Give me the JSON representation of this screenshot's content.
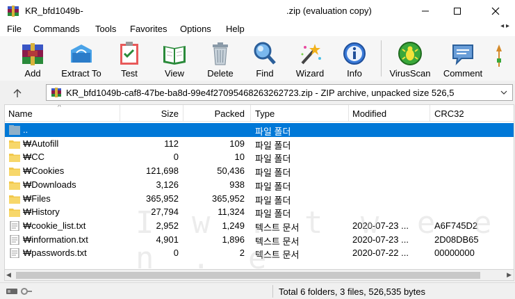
{
  "window": {
    "title_left": "KR_bfd1049b-",
    "title_right": ".zip (evaluation copy)"
  },
  "menu": [
    "File",
    "Commands",
    "Tools",
    "Favorites",
    "Options",
    "Help"
  ],
  "toolbar": [
    {
      "label": "Add",
      "icon": "add-archive-icon"
    },
    {
      "label": "Extract To",
      "icon": "extract-icon"
    },
    {
      "label": "Test",
      "icon": "test-icon"
    },
    {
      "label": "View",
      "icon": "view-book-icon"
    },
    {
      "label": "Delete",
      "icon": "trash-icon"
    },
    {
      "label": "Find",
      "icon": "magnifier-icon"
    },
    {
      "label": "Wizard",
      "icon": "wand-icon"
    },
    {
      "label": "Info",
      "icon": "info-icon"
    },
    {
      "label": "VirusScan",
      "icon": "bug-icon"
    },
    {
      "label": "Comment",
      "icon": "comment-icon"
    }
  ],
  "address": {
    "path": "KR_bfd1049b-caf8-47be-ba8d-99e4f27095468263262723.zip - ZIP archive, unpacked size 526,5"
  },
  "columns": {
    "name": "Name",
    "size": "Size",
    "packed": "Packed",
    "type": "Type",
    "modified": "Modified",
    "crc": "CRC32"
  },
  "files": [
    {
      "name": "..",
      "size": "",
      "packed": "",
      "type": "파일 폴더",
      "modified": "",
      "crc": "",
      "kind": "parent"
    },
    {
      "name": "₩Autofill",
      "size": "112",
      "packed": "109",
      "type": "파일 폴더",
      "modified": "",
      "crc": "",
      "kind": "folder"
    },
    {
      "name": "₩CC",
      "size": "0",
      "packed": "10",
      "type": "파일 폴더",
      "modified": "",
      "crc": "",
      "kind": "folder"
    },
    {
      "name": "₩Cookies",
      "size": "121,698",
      "packed": "50,436",
      "type": "파일 폴더",
      "modified": "",
      "crc": "",
      "kind": "folder"
    },
    {
      "name": "₩Downloads",
      "size": "3,126",
      "packed": "938",
      "type": "파일 폴더",
      "modified": "",
      "crc": "",
      "kind": "folder"
    },
    {
      "name": "₩Files",
      "size": "365,952",
      "packed": "365,952",
      "type": "파일 폴더",
      "modified": "",
      "crc": "",
      "kind": "folder"
    },
    {
      "name": "₩History",
      "size": "27,794",
      "packed": "11,324",
      "type": "파일 폴더",
      "modified": "",
      "crc": "",
      "kind": "folder"
    },
    {
      "name": "₩cookie_list.txt",
      "size": "2,952",
      "packed": "1,249",
      "type": "텍스트 문서",
      "modified": "2020-07-23 ...",
      "crc": "A6F745D2",
      "kind": "text"
    },
    {
      "name": "₩information.txt",
      "size": "4,901",
      "packed": "1,896",
      "type": "텍스트 문서",
      "modified": "2020-07-23 ...",
      "crc": "2D08DB65",
      "kind": "text"
    },
    {
      "name": "₩passwords.txt",
      "size": "0",
      "packed": "2",
      "type": "텍스트 문서",
      "modified": "2020-07-22 ...",
      "crc": "00000000",
      "kind": "text"
    }
  ],
  "status": {
    "text": "Total 6 folders, 3 files, 526,535 bytes"
  },
  "watermark": "I w . t w e e n . e",
  "colors": {
    "selection": "#0078d7",
    "folder": "#f2c84b"
  }
}
